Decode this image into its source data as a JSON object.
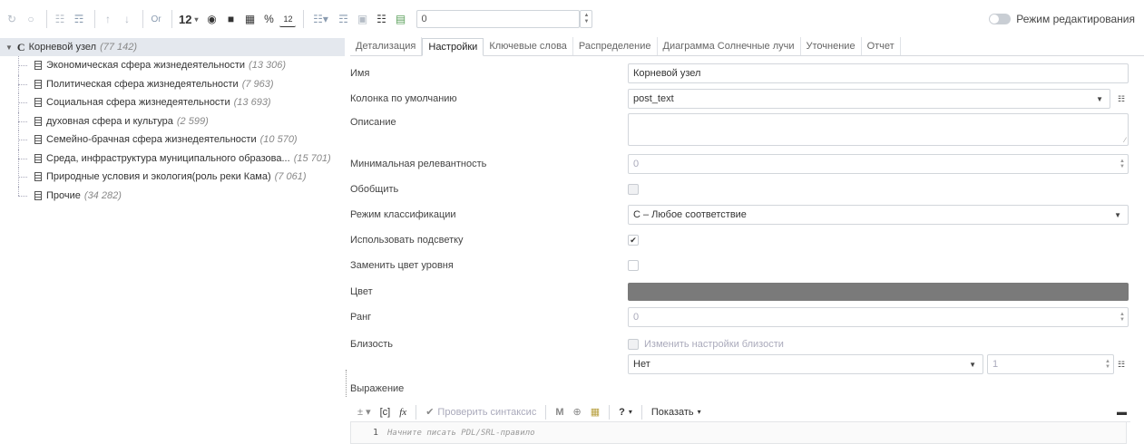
{
  "toolbar": {
    "level_value": "12",
    "number_input_value": "0",
    "or_label": "Or",
    "pct_label": "%",
    "sort_label": "12"
  },
  "edit_mode": {
    "label": "Режим редактирования",
    "enabled": false
  },
  "tree": {
    "root": {
      "prefix": "C",
      "label": "Корневой узел",
      "count": "(77 142)"
    },
    "items": [
      {
        "label": "Экономическая сфера жизнедеятельности",
        "count": "(13 306)"
      },
      {
        "label": "Политическая сфера жизнедеятельности",
        "count": "(7 963)"
      },
      {
        "label": "Социальная сфера жизнедеятельности",
        "count": "(13 693)"
      },
      {
        "label": "духовная сфера и культура",
        "count": "(2 599)"
      },
      {
        "label": "Семейно-брачная сфера жизнедеятельности",
        "count": "(10 570)"
      },
      {
        "label": "Среда, инфраструктура муниципального образова...",
        "count": "(15 701)"
      },
      {
        "label": "Природные условия и экология(роль реки Кама)",
        "count": "(7 061)"
      },
      {
        "label": "Прочие",
        "count": "(34 282)"
      }
    ]
  },
  "tabs": [
    {
      "label": "Детализация",
      "active": false
    },
    {
      "label": "Настройки",
      "active": true
    },
    {
      "label": "Ключевые слова",
      "active": false
    },
    {
      "label": "Распределение",
      "active": false
    },
    {
      "label": "Диаграмма Солнечные лучи",
      "active": false
    },
    {
      "label": "Уточнение",
      "active": false
    },
    {
      "label": "Отчет",
      "active": false
    }
  ],
  "form": {
    "name": {
      "label": "Имя",
      "value": "Корневой узел"
    },
    "default_column": {
      "label": "Колонка по умолчанию",
      "value": "post_text"
    },
    "description": {
      "label": "Описание",
      "value": ""
    },
    "min_relevance": {
      "label": "Минимальная релевантность",
      "value": "0"
    },
    "generalize": {
      "label": "Обобщить",
      "checked": false
    },
    "classification_mode": {
      "label": "Режим классификации",
      "value": "C – Любое соответствие"
    },
    "use_highlight": {
      "label": "Использовать подсветку",
      "checked": true
    },
    "replace_level_color": {
      "label": "Заменить цвет уровня",
      "checked": false
    },
    "color": {
      "label": "Цвет",
      "value": "#7a7a7a"
    },
    "rank": {
      "label": "Ранг",
      "value": "0"
    },
    "proximity": {
      "label": "Близость",
      "change_label": "Изменить настройки близости",
      "select_value": "Нет",
      "number_value": "1"
    },
    "expression": {
      "label": "Выражение"
    }
  },
  "editor": {
    "check_syntax_label": "Проверить синтаксис",
    "m_label": "M",
    "show_label": "Показать",
    "help_label": "?",
    "line_number": "1",
    "placeholder": "Начните писать PDL/SRL-правило"
  }
}
